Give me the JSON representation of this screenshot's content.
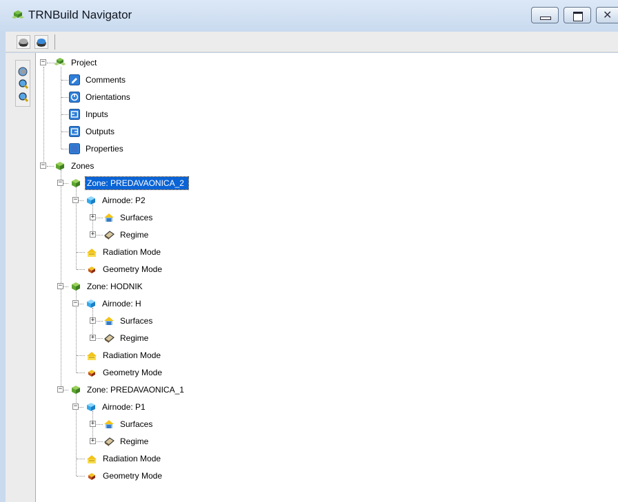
{
  "window": {
    "title": "TRNBuild Navigator"
  },
  "toolbar": {
    "buttons": [
      "open-project-icon",
      "open-zone-icon"
    ]
  },
  "sidebar": {
    "buttons": [
      "view-icon",
      "zoom-in-icon",
      "zoom-out-icon"
    ]
  },
  "tree": {
    "project": {
      "label": "Project",
      "children": [
        "Comments",
        "Orientations",
        "Inputs",
        "Outputs",
        "Properties"
      ]
    },
    "zones_label": "Zones",
    "zones": [
      {
        "label": "Zone: PREDAVAONICA_2",
        "airnode": "Airnode: P2",
        "selected": true
      },
      {
        "label": "Zone: HODNIK",
        "airnode": "Airnode: H",
        "selected": false
      },
      {
        "label": "Zone: PREDAVAONICA_1",
        "airnode": "Airnode: P1",
        "selected": false
      }
    ],
    "airnode_children": [
      "Surfaces",
      "Regime"
    ],
    "zone_children": [
      "Radiation Mode",
      "Geometry Mode"
    ]
  },
  "colors": {
    "selection": "#0a64d6",
    "titlebar": "#c9daef"
  }
}
